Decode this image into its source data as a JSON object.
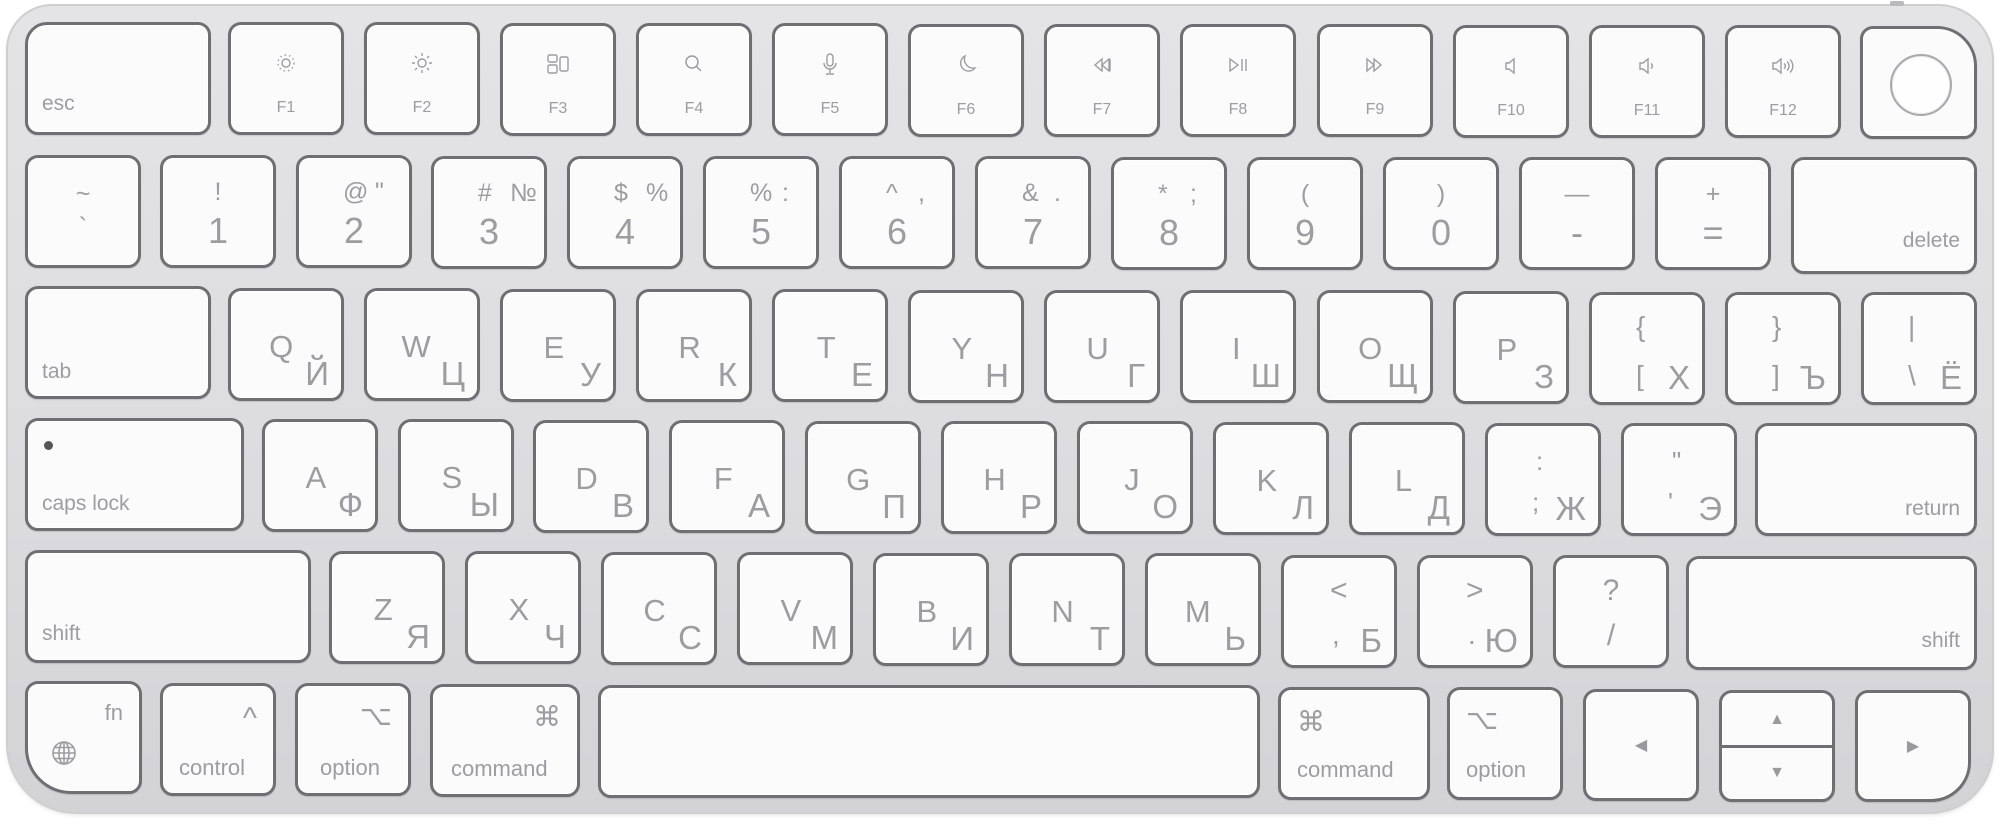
{
  "device": "Magic Keyboard with Touch ID (Russian layout)",
  "colors": {
    "body": "#dedee0",
    "key": "#fbfbfb",
    "key_border": "#6f6f73",
    "legend": "#9d9da1"
  },
  "row_fn": {
    "esc": "esc",
    "keys": [
      {
        "label": "F1",
        "icon": "brightness-down-icon"
      },
      {
        "label": "F2",
        "icon": "brightness-up-icon"
      },
      {
        "label": "F3",
        "icon": "mission-control-icon"
      },
      {
        "label": "F4",
        "icon": "spotlight-search-icon"
      },
      {
        "label": "F5",
        "icon": "dictation-mic-icon"
      },
      {
        "label": "F6",
        "icon": "do-not-disturb-moon-icon"
      },
      {
        "label": "F7",
        "icon": "rewind-icon"
      },
      {
        "label": "F8",
        "icon": "play-pause-icon"
      },
      {
        "label": "F9",
        "icon": "fast-forward-icon"
      },
      {
        "label": "F10",
        "icon": "mute-icon"
      },
      {
        "label": "F11",
        "icon": "volume-down-icon"
      },
      {
        "label": "F12",
        "icon": "volume-up-icon"
      }
    ],
    "touch_id": "touch-id-icon"
  },
  "row_num": {
    "keys": [
      {
        "top": "~",
        "bottom": "`",
        "top2": ""
      },
      {
        "top": "!",
        "bottom": "1",
        "top2": ""
      },
      {
        "top": "@",
        "bottom": "2",
        "top2": "\""
      },
      {
        "top": "#",
        "bottom": "3",
        "top2": "№"
      },
      {
        "top": "$",
        "bottom": "4",
        "top2": "%"
      },
      {
        "top": "%",
        "bottom": "5",
        "top2": ":"
      },
      {
        "top": "^",
        "bottom": "6",
        "top2": ","
      },
      {
        "top": "&",
        "bottom": "7",
        "top2": "."
      },
      {
        "top": "*",
        "bottom": "8",
        "top2": ";"
      },
      {
        "top": "(",
        "bottom": "9",
        "top2": ""
      },
      {
        "top": ")",
        "bottom": "0",
        "top2": ""
      },
      {
        "top": "—",
        "bottom": "-",
        "top2": ""
      },
      {
        "top": "+",
        "bottom": "=",
        "top2": ""
      }
    ],
    "delete": "delete"
  },
  "row_q": {
    "tab": "tab",
    "keys": [
      {
        "lat": "Q",
        "cyr": "Й"
      },
      {
        "lat": "W",
        "cyr": "Ц"
      },
      {
        "lat": "E",
        "cyr": "У"
      },
      {
        "lat": "R",
        "cyr": "К"
      },
      {
        "lat": "T",
        "cyr": "Е"
      },
      {
        "lat": "Y",
        "cyr": "Н"
      },
      {
        "lat": "U",
        "cyr": "Г"
      },
      {
        "lat": "I",
        "cyr": "Ш"
      },
      {
        "lat": "O",
        "cyr": "Щ"
      },
      {
        "lat": "P",
        "cyr": "З"
      }
    ],
    "brackets": [
      {
        "top": "{",
        "bottom": "[",
        "cyr": "Х"
      },
      {
        "top": "}",
        "bottom": "]",
        "cyr": "Ъ"
      },
      {
        "top": "|",
        "bottom": "\\",
        "cyr": "Ё"
      }
    ]
  },
  "row_a": {
    "caps": "caps lock",
    "keys": [
      {
        "lat": "A",
        "cyr": "Ф"
      },
      {
        "lat": "S",
        "cyr": "Ы"
      },
      {
        "lat": "D",
        "cyr": "В"
      },
      {
        "lat": "F",
        "cyr": "А"
      },
      {
        "lat": "G",
        "cyr": "П"
      },
      {
        "lat": "H",
        "cyr": "Р"
      },
      {
        "lat": "J",
        "cyr": "О"
      },
      {
        "lat": "K",
        "cyr": "Л"
      },
      {
        "lat": "L",
        "cyr": "Д"
      }
    ],
    "punct": [
      {
        "top": ":",
        "bottom": ";",
        "cyr": "Ж"
      },
      {
        "top": "\"",
        "bottom": "'",
        "cyr": "Э"
      }
    ],
    "return": "return"
  },
  "row_z": {
    "shift_left": "shift",
    "keys": [
      {
        "lat": "Z",
        "cyr": "Я"
      },
      {
        "lat": "X",
        "cyr": "Ч"
      },
      {
        "lat": "C",
        "cyr": "С"
      },
      {
        "lat": "V",
        "cyr": "М"
      },
      {
        "lat": "B",
        "cyr": "И"
      },
      {
        "lat": "N",
        "cyr": "Т"
      },
      {
        "lat": "M",
        "cyr": "Ь"
      }
    ],
    "punct": [
      {
        "top": "<",
        "bottom": ",",
        "cyr": "Б"
      },
      {
        "top": ">",
        "bottom": ".",
        "cyr": "Ю"
      },
      {
        "top": "?",
        "bottom": "/",
        "cyr": ""
      }
    ],
    "shift_right": "shift"
  },
  "row_bottom": {
    "fn": "fn",
    "globe": "globe-icon",
    "control": "control",
    "control_sym": "^",
    "option": "option",
    "option_sym": "⌥",
    "command": "command",
    "command_sym": "⌘",
    "arrows": {
      "left": "◀",
      "right": "▶",
      "up": "▲",
      "down": "▼"
    }
  }
}
